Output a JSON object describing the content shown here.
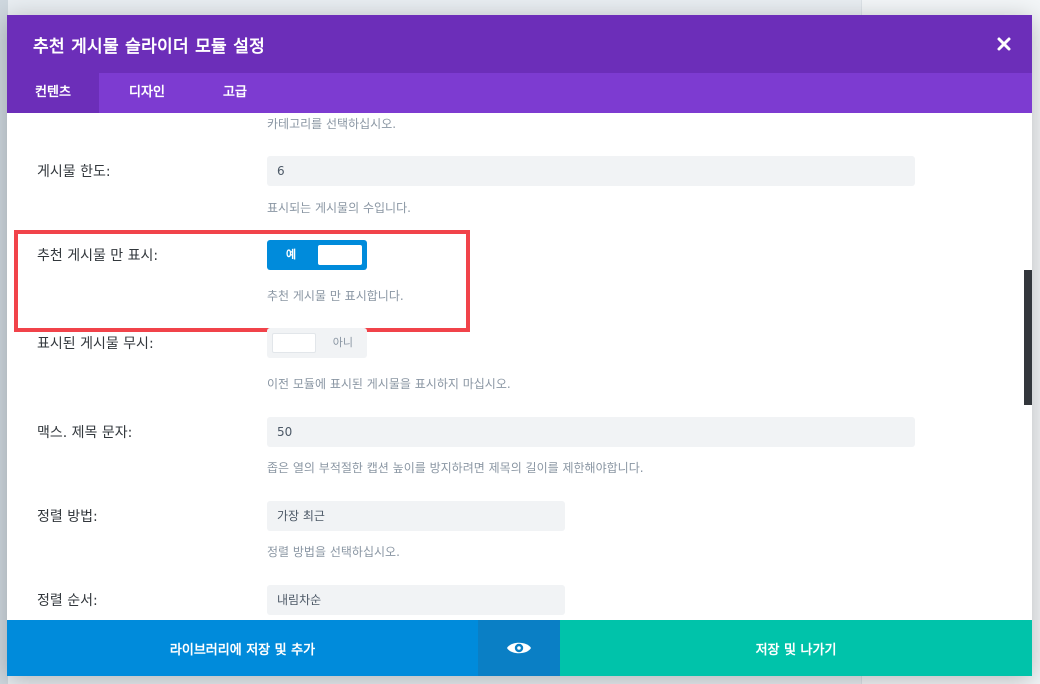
{
  "modal": {
    "title": "추천 게시물 슬라이더 모듈 설정"
  },
  "tabs": [
    {
      "label": "컨텐츠",
      "active": true
    },
    {
      "label": "디자인",
      "active": false
    },
    {
      "label": "고급",
      "active": false
    }
  ],
  "fields": {
    "category_desc": "카테고리를 선택하십시오.",
    "post_limit": {
      "label": "게시물 한도:",
      "value": "6",
      "desc": "표시되는 게시물의 수입니다."
    },
    "featured_only": {
      "label": "추천 게시물 만 표시:",
      "toggle": "예",
      "state": "on",
      "desc": "추천 게시물 만 표시합니다."
    },
    "ignore_displayed": {
      "label": "표시된 게시물 무시:",
      "toggle": "아니",
      "state": "off",
      "desc": "이전 모듈에 표시된 게시물을 표시하지 마십시오."
    },
    "max_title_chars": {
      "label": "맥스. 제목 문자:",
      "value": "50",
      "desc": "좁은 열의 부적절한 캡션 높이를 방지하려면 제목의 길이를 제한해야합니다."
    },
    "sort_method": {
      "label": "정렬 방법:",
      "value": "가장 최근",
      "desc": "정렬 방법을 선택하십시오."
    },
    "sort_order": {
      "label": "정렬 순서:",
      "value": "내림차순"
    }
  },
  "footer": {
    "library_label": "라이브러리에 저장 및 추가",
    "preview_icon": "eye-icon",
    "save_label": "저장 및 나가기"
  },
  "colors": {
    "header": "#6c2eb9",
    "tabs": "#7d3bd1",
    "toggle_on": "#008bdb",
    "library_button": "#008bdb",
    "save_button": "#00c3aa",
    "highlight": "#f1434a"
  }
}
